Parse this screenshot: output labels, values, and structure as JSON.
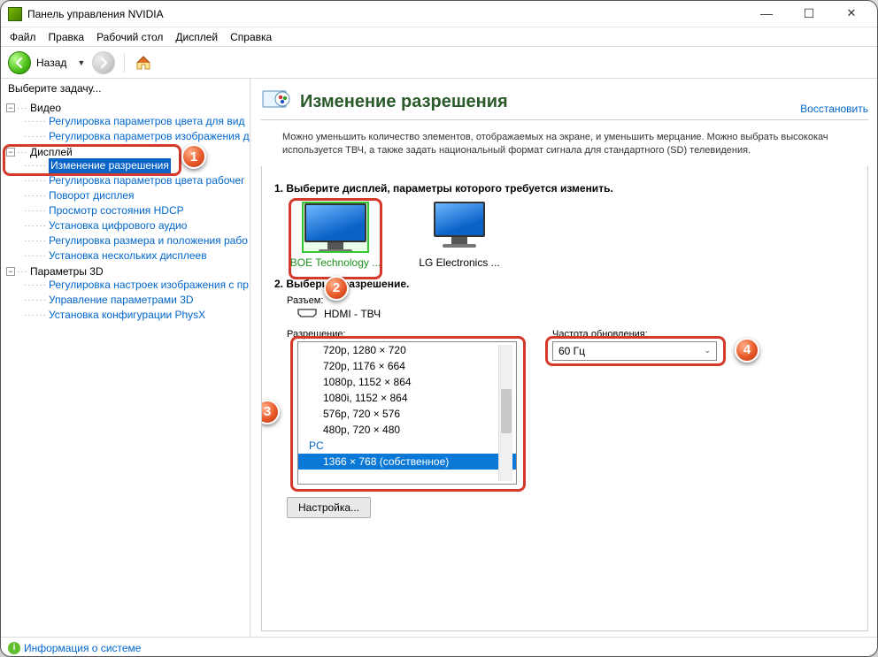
{
  "window": {
    "title": "Панель управления NVIDIA"
  },
  "menu": [
    "Файл",
    "Правка",
    "Рабочий стол",
    "Дисплей",
    "Справка"
  ],
  "toolbar": {
    "back": "Назад"
  },
  "sidebar": {
    "task_label": "Выберите задачу...",
    "cats": [
      {
        "name": "Видео",
        "items": [
          "Регулировка параметров цвета для вид",
          "Регулировка параметров изображения д"
        ]
      },
      {
        "name": "Дисплей",
        "items": [
          "Изменение разрешения",
          "Регулировка параметров цвета рабочег",
          "Поворот дисплея",
          "Просмотр состояния HDCP",
          "Установка цифрового аудио",
          "Регулировка размера и положения рабо",
          "Установка нескольких дисплеев"
        ]
      },
      {
        "name": "Параметры 3D",
        "items": [
          "Регулировка настроек изображения с пр",
          "Управление параметрами 3D",
          "Установка конфигурации PhysX"
        ]
      }
    ]
  },
  "page": {
    "title": "Изменение разрешения",
    "restore": "Восстановить",
    "description": "Можно уменьшить количество элементов, отображаемых на экране, и уменьшить мерцание. Можно выбрать высококач используется ТВЧ, а также задать национальный формат сигнала для стандартного (SD) телевидения.",
    "step1": "1. Выберите дисплей, параметры которого требуется изменить.",
    "displays": [
      {
        "name": "BOE Technology ...",
        "selected": true
      },
      {
        "name": "LG Electronics ...",
        "selected": false
      }
    ],
    "step2": "2. Выберите разрешение.",
    "connector_label": "Разъем:",
    "connector_value": "HDMI - ТВЧ",
    "resolution_label": "Разрешение:",
    "resolutions": [
      {
        "t": "720p, 1280 × 720"
      },
      {
        "t": "720p, 1176 × 664"
      },
      {
        "t": "1080p, 1152 × 864"
      },
      {
        "t": "1080i, 1152 × 864"
      },
      {
        "t": "576p, 720 × 576"
      },
      {
        "t": "480p, 720 × 480"
      }
    ],
    "res_group": "PC",
    "res_selected": "1366 × 768 (собственное)",
    "refresh_label": "Частота обновления:",
    "refresh_value": "60 Гц",
    "customize": "Настройка..."
  },
  "status": {
    "info": "Информация о системе"
  },
  "annotations": [
    "1",
    "2",
    "3",
    "4"
  ]
}
